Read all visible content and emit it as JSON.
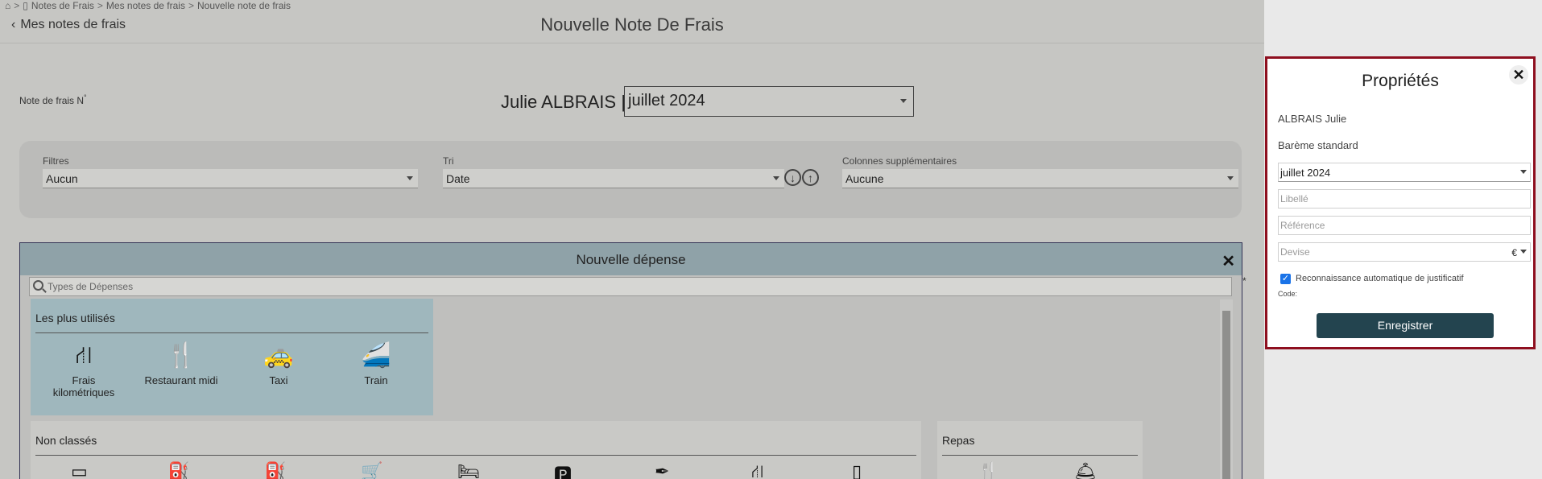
{
  "breadcrumb": {
    "items": [
      "Notes de Frais",
      "Mes notes de frais",
      "Nouvelle note de frais"
    ],
    "separator": ">"
  },
  "header": {
    "back_label": "Mes notes de frais",
    "title": "Nouvelle Note De Frais"
  },
  "note": {
    "label": "Note de frais N",
    "label_suffix": "°",
    "employee": "Julie ALBRAIS |",
    "month": "juillet 2024"
  },
  "filters": {
    "filtres_label": "Filtres",
    "filtres_value": "Aucun",
    "tri_label": "Tri",
    "tri_value": "Date",
    "colonnes_label": "Colonnes supplémentaires",
    "colonnes_value": "Aucune"
  },
  "depense": {
    "title": "Nouvelle dépense",
    "search_placeholder": "Types de Dépenses",
    "most_used": {
      "title": "Les plus utilisés",
      "items": [
        "Frais\nkilométriques",
        "Restaurant midi",
        "Taxi",
        "Train"
      ]
    },
    "unclassified": {
      "title": "Non classés"
    },
    "meals": {
      "title": "Repas"
    }
  },
  "props": {
    "title": "Propriétés",
    "employee": "ALBRAIS Julie",
    "bareme": "Barème standard",
    "month": "juillet 2024",
    "libelle_placeholder": "Libellé",
    "reference_placeholder": "Référence",
    "devise_placeholder": "Devise",
    "devise_symbol": "€",
    "auto_recognition": "Reconnaissance automatique de justificatif",
    "code_label": "Code:",
    "save_label": "Enregistrer"
  },
  "asterisk": "*",
  "colors": {
    "panel_header": "#8fa2a8",
    "save_button": "#23444f",
    "props_border": "#8e0f1f",
    "most_used_bg": "#9fb7bd"
  }
}
